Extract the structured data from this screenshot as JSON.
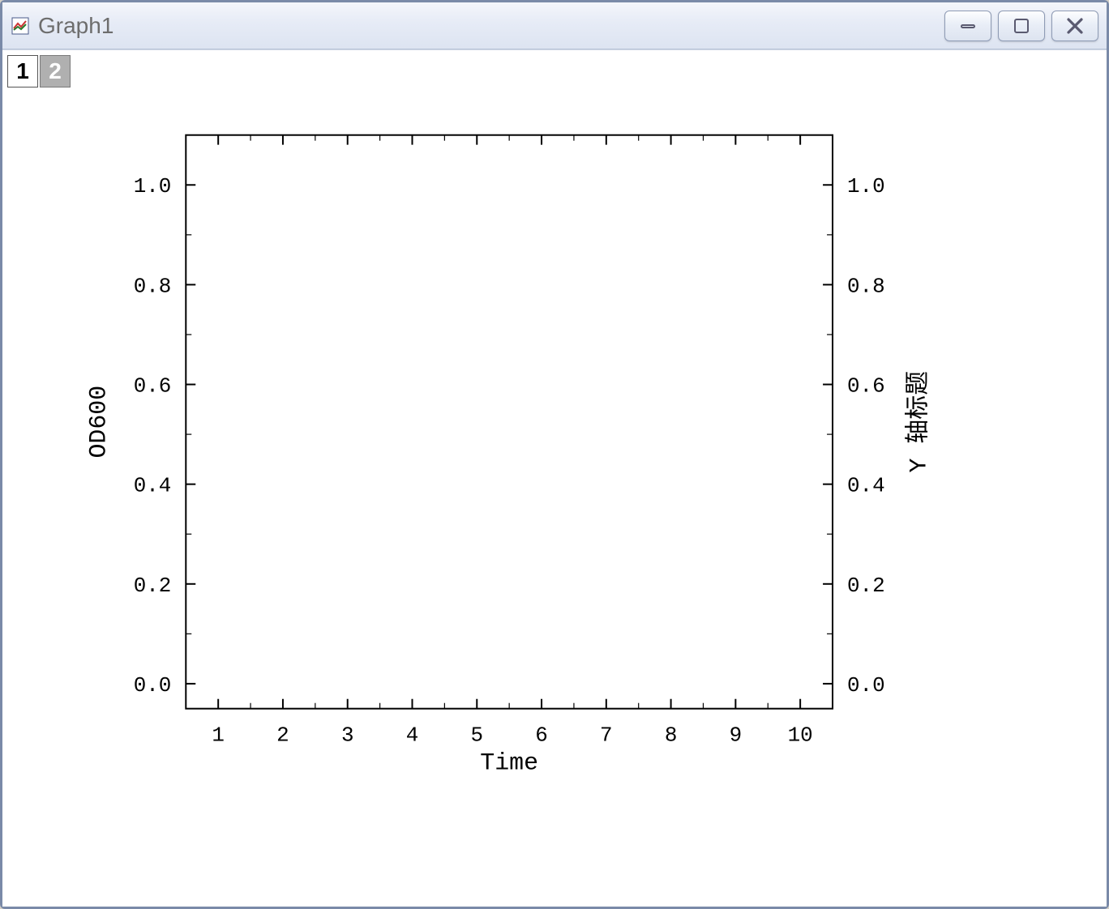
{
  "window": {
    "title": "Graph1"
  },
  "layers": {
    "tabs": [
      "1",
      "2"
    ],
    "activeIndex": 0
  },
  "chart_data": {
    "type": "line",
    "series": [],
    "x_ticks": [
      1,
      2,
      3,
      4,
      5,
      6,
      7,
      8,
      9,
      10
    ],
    "y_left_ticks": [
      "0.0",
      "0.2",
      "0.4",
      "0.6",
      "0.8",
      "1.0"
    ],
    "y_right_ticks": [
      "0.0",
      "0.2",
      "0.4",
      "0.6",
      "0.8",
      "1.0"
    ],
    "xlabel": "Time",
    "ylabel_left": "OD600",
    "ylabel_right": "Y 轴标题",
    "xlim": [
      0.5,
      10.5
    ],
    "ylim_left": [
      -0.05,
      1.1
    ],
    "ylim_right": [
      -0.05,
      1.1
    ]
  }
}
